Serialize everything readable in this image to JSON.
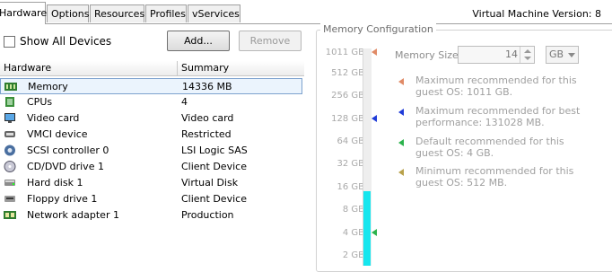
{
  "tabs": [
    {
      "label": "Hardware",
      "active": true
    },
    {
      "label": "Options"
    },
    {
      "label": "Resources"
    },
    {
      "label": "Profiles"
    },
    {
      "label": "vServices"
    }
  ],
  "vm_version": "Virtual Machine Version: 8",
  "show_all_devices": {
    "label": "Show All Devices",
    "checked": false
  },
  "buttons": {
    "add": "Add...",
    "remove": "Remove"
  },
  "hardware_table": {
    "headers": [
      "Hardware",
      "Summary"
    ],
    "rows": [
      {
        "name": "Memory",
        "summary": "14336 MB",
        "icon": "memory-icon",
        "selected": true
      },
      {
        "name": "CPUs",
        "summary": "4",
        "icon": "cpu-icon"
      },
      {
        "name": "Video card",
        "summary": "Video card",
        "icon": "video-card-icon"
      },
      {
        "name": "VMCI device",
        "summary": "Restricted",
        "icon": "vmci-device-icon"
      },
      {
        "name": "SCSI controller 0",
        "summary": "LSI Logic SAS",
        "icon": "scsi-controller-icon"
      },
      {
        "name": "CD/DVD drive 1",
        "summary": "Client Device",
        "icon": "cd-dvd-drive-icon"
      },
      {
        "name": "Hard disk 1",
        "summary": "Virtual Disk",
        "icon": "hard-disk-icon"
      },
      {
        "name": "Floppy drive 1",
        "summary": "Client Device",
        "icon": "floppy-drive-icon"
      },
      {
        "name": "Network adapter 1",
        "summary": "Production",
        "icon": "network-adapter-icon"
      }
    ]
  },
  "memory_config": {
    "title": "Memory Configuration",
    "scale_labels": [
      "1011 GB",
      "512 GB",
      "256 GB",
      "128 GB",
      "64 GB",
      "32 GB",
      "16 GB",
      "8 GB",
      "4 GB",
      "2 GB"
    ],
    "memory_size_label": "Memory Size:",
    "memory_size_value": "14",
    "unit": "GB",
    "legend": [
      {
        "text": "Maximum recommended for this guest OS: 1011 GB.",
        "color": "#e08a66",
        "icon": "max-recommended-marker-icon"
      },
      {
        "text": "Maximum recommended for best performance: 131028 MB.",
        "color": "#1f3bd8",
        "icon": "best-performance-marker-icon"
      },
      {
        "text": "Default recommended for this guest OS: 4 GB.",
        "color": "#2bb24c",
        "icon": "default-recommended-marker-icon"
      },
      {
        "text": "Minimum recommended for this guest OS: 512 MB.",
        "color": "#b8a14a",
        "icon": "min-recommended-marker-icon"
      }
    ],
    "slider_markers": [
      {
        "at": "1011 GB",
        "color": "#e08a66"
      },
      {
        "at": "128 GB",
        "color": "#1f3bd8"
      },
      {
        "at": "4 GB",
        "color": "#2bb24c"
      }
    ],
    "fill_color": "#16e6ee"
  }
}
